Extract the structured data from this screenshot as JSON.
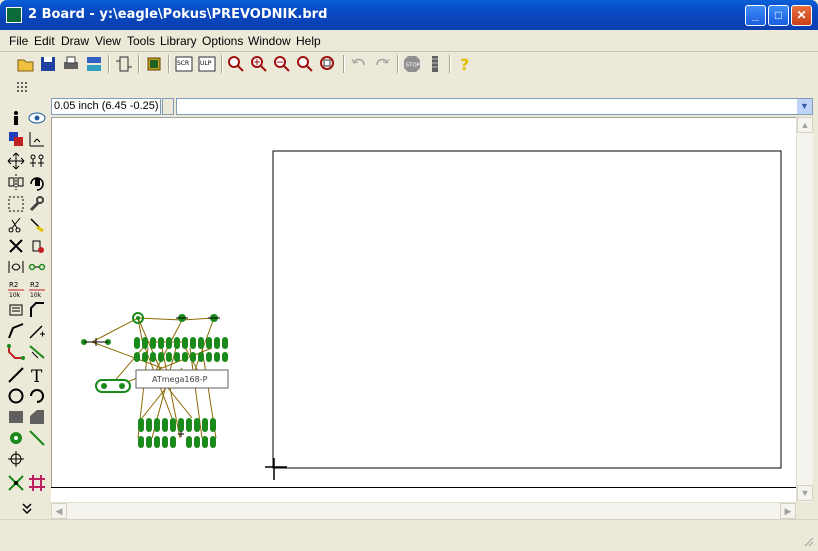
{
  "window": {
    "title": "2 Board - y:\\eagle\\Pokus\\PREVODNIK.brd",
    "minimize": "_",
    "maximize": "□",
    "close": "✕"
  },
  "menu": [
    "File",
    "Edit",
    "Draw",
    "View",
    "Tools",
    "Library",
    "Options",
    "Window",
    "Help"
  ],
  "coordinate": "0.05 inch (6.45 -0.25)",
  "command_input": "",
  "board": {
    "chip_label": "ATmega168-P"
  },
  "colors": {
    "titlebar": "#0848c0",
    "pad_green": "#1a8a1a",
    "airwire": "#8a6a00"
  }
}
